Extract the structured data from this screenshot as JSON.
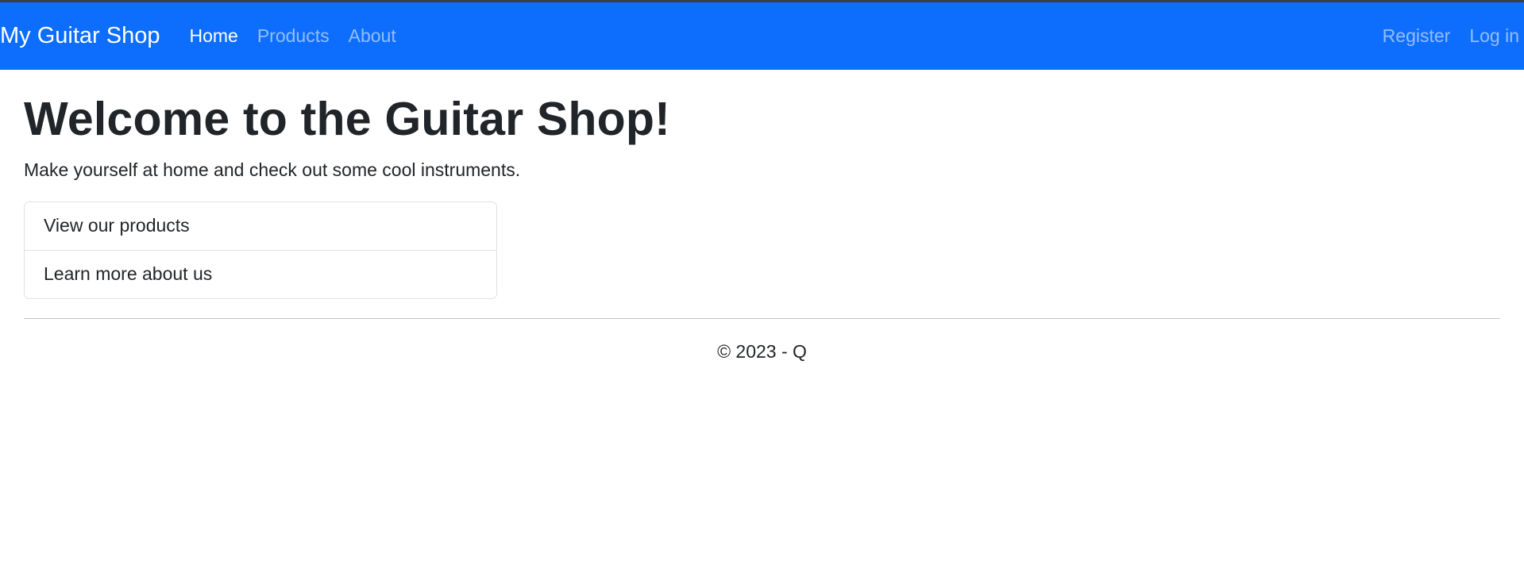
{
  "navbar": {
    "brand": "My Guitar Shop",
    "links": [
      {
        "label": "Home"
      },
      {
        "label": "Products"
      },
      {
        "label": "About"
      }
    ],
    "auth": [
      {
        "label": "Register"
      },
      {
        "label": "Log in"
      }
    ],
    "background_color": "#0d6efd"
  },
  "main": {
    "heading": "Welcome to the Guitar Shop!",
    "lead": "Make yourself at home and check out some cool instruments.",
    "list_items": [
      {
        "label": "View our products"
      },
      {
        "label": "Learn more about us"
      }
    ]
  },
  "footer": {
    "text": "© 2023 - Q"
  }
}
